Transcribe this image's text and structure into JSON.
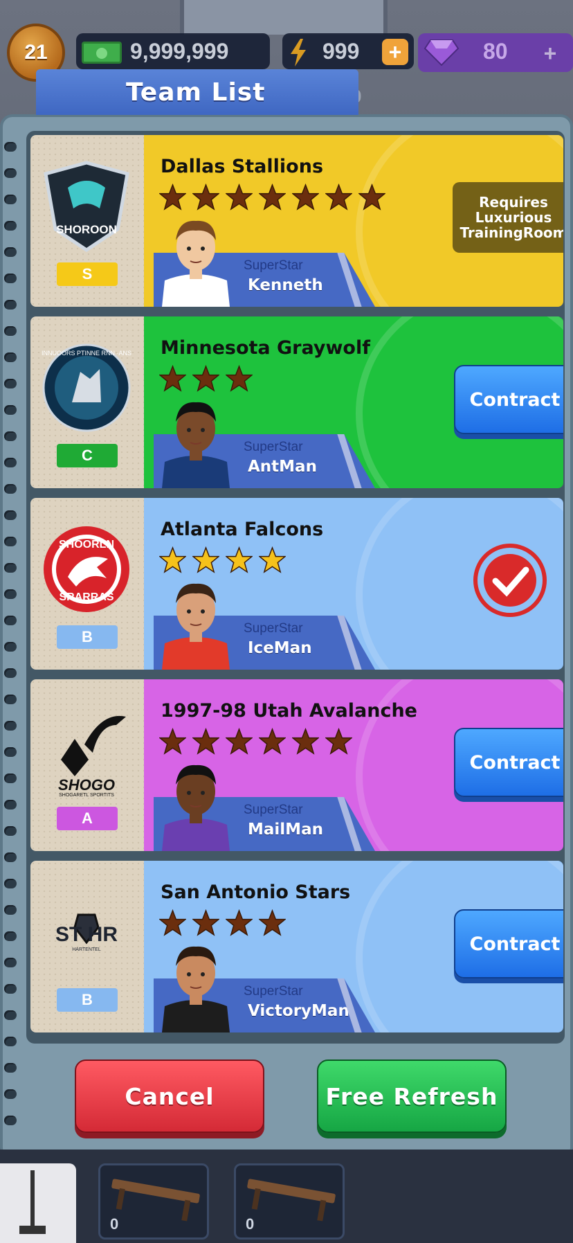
{
  "hud": {
    "level": "21",
    "cash": "9,999,999",
    "energy": "999",
    "gems": "80",
    "hidden_partial": "9"
  },
  "dialog": {
    "title": "Team List",
    "cancel_label": "Cancel",
    "refresh_label": "Free Refresh"
  },
  "teams": [
    {
      "name": "Dallas Stallions",
      "grade": "S",
      "stars": 7,
      "superstar_label": "SuperStar",
      "player": "Kenneth",
      "action_text": "Requires Luxurious TrainingRoom",
      "colors": {
        "bg": "#f1c928",
        "grade": "#f5c918",
        "star": "#6b2e0e"
      }
    },
    {
      "name": "Minnesota Graywolf",
      "grade": "C",
      "stars": 3,
      "superstar_label": "SuperStar",
      "player": "AntMan",
      "action_text": "Contract",
      "colors": {
        "bg": "#1ec23d",
        "grade": "#1faa35",
        "star": "#6b2e0e"
      }
    },
    {
      "name": "Atlanta Falcons",
      "grade": "B",
      "stars": 4,
      "superstar_label": "SuperStar",
      "player": "IceMan",
      "action_text": "",
      "colors": {
        "bg": "#8fc1f6",
        "grade": "#86b8f0",
        "star": "#f5c21b"
      }
    },
    {
      "name": "1997-98 Utah Avalanche",
      "grade": "A",
      "stars": 6,
      "superstar_label": "SuperStar",
      "player": "MailMan",
      "action_text": "Contract",
      "colors": {
        "bg": "#d764e6",
        "grade": "#cc57e0",
        "star": "#6b2e0e"
      }
    },
    {
      "name": "San Antonio Stars",
      "grade": "B",
      "stars": 4,
      "superstar_label": "SuperStar",
      "player": "VictoryMan",
      "action_text": "Contract",
      "colors": {
        "bg": "#8fc1f6",
        "grade": "#86b8f0",
        "star": "#6b2e0e"
      }
    }
  ],
  "logos": {
    "team0_text": "SHOROON",
    "team1_text": "INNUOORS PTINNE RNN ·ANS",
    "team2_top": "SHOORLN",
    "team2_bottom": "SRARRAS",
    "team3_text": "SHOGO",
    "team3_sub": "SHOGARETL SPORTITS",
    "team4_text": "ST HR",
    "team4_sub": "HARTENTEL"
  },
  "bottom_slots": [
    "0",
    "0"
  ],
  "icons": [
    "cash-icon",
    "energy-icon",
    "gem-icon",
    "plus-icon",
    "star-icon",
    "check-stamp-icon"
  ]
}
